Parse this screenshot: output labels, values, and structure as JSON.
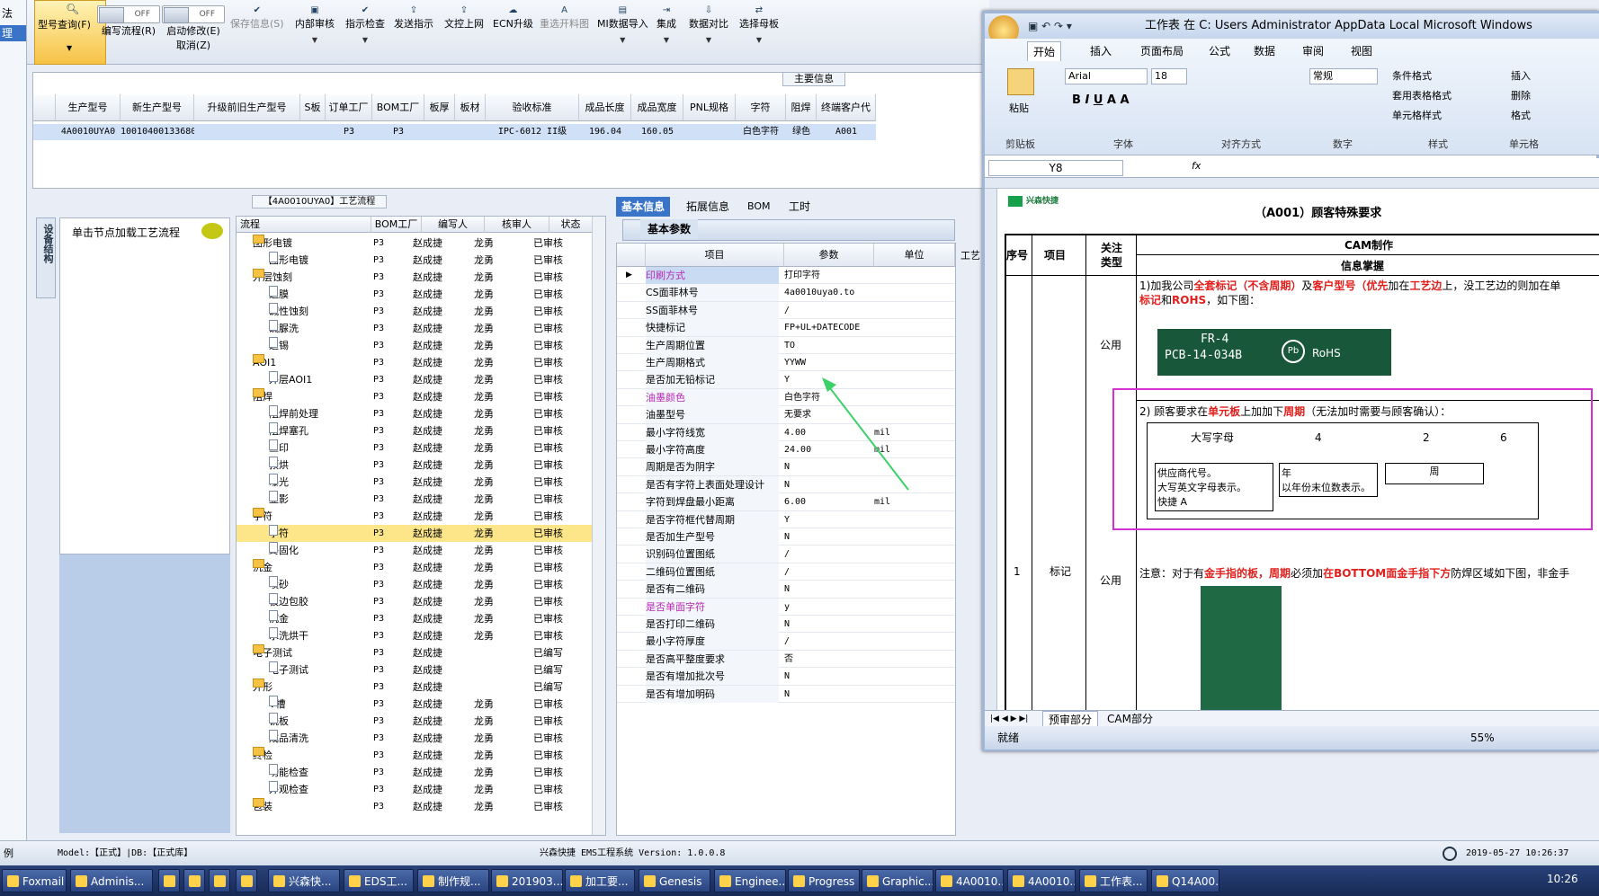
{
  "toolbar": {
    "buttons": [
      {
        "label": "型号查询(F)",
        "icon": "search-icon"
      },
      {
        "label": "编写流程(R)",
        "toggle": "OFF"
      },
      {
        "label": "启动修改(E)",
        "sub": "取消(Z)",
        "toggle": "OFF"
      },
      {
        "label": "保存信息(S)",
        "icon": "check-icon"
      },
      {
        "label": "内部审核",
        "icon": "print-icon"
      },
      {
        "label": "指示检查",
        "icon": "check-icon"
      },
      {
        "label": "发送指示",
        "icon": "upload-icon"
      },
      {
        "label": "文控上网",
        "icon": "upload-icon"
      },
      {
        "label": "ECN升级",
        "icon": "cloud-icon"
      },
      {
        "label": "重选开料图",
        "icon": "font-icon"
      },
      {
        "label": "MI数据导入",
        "icon": "image-icon"
      },
      {
        "label": "集成",
        "icon": "import-icon"
      },
      {
        "label": "数据对比",
        "icon": "download-icon"
      },
      {
        "label": "选择母板",
        "icon": "compare-icon"
      }
    ]
  },
  "left_strip": {
    "items": [
      "法",
      "理"
    ]
  },
  "main": {
    "caption": "主要信息",
    "columns": [
      "生产型号",
      "新生产型号",
      "升级前旧生产型号",
      "S板",
      "订单工厂",
      "BOM工厂",
      "板厚",
      "板材",
      "验收标准",
      "成品长度",
      "成品宽度",
      "PNL规格",
      "字符",
      "阻焊",
      "终端客户代码"
    ],
    "row": [
      "4A0010UYA0",
      "10010400133680",
      "",
      "",
      "P3",
      "P3",
      "",
      "",
      "IPC-6012 II级",
      "196.04",
      "160.05",
      "",
      "白色字符",
      "绿色",
      "A001"
    ]
  },
  "process": {
    "caption": "【4A0010UYA0】工艺流程",
    "vtab": "设备结构",
    "hint": "单击节点加载工艺流程",
    "columns": [
      "流程",
      "BOM工厂",
      "编写人",
      "核审人",
      "状态"
    ],
    "rows": [
      {
        "level": 1,
        "type": "folder",
        "name": "图形电镀",
        "bom": "P3",
        "author": "赵成捷",
        "reviewer": "龙勇",
        "status": "已审核"
      },
      {
        "level": 2,
        "type": "doc",
        "name": "图形电镀",
        "bom": "P3",
        "author": "赵成捷",
        "reviewer": "龙勇",
        "status": "已审核"
      },
      {
        "level": 1,
        "type": "folder",
        "name": "外层蚀刻",
        "bom": "P3",
        "author": "赵成捷",
        "reviewer": "龙勇",
        "status": "已审核"
      },
      {
        "level": 2,
        "type": "doc",
        "name": "退膜",
        "bom": "P3",
        "author": "赵成捷",
        "reviewer": "龙勇",
        "status": "已审核"
      },
      {
        "level": 2,
        "type": "doc",
        "name": "碱性蚀刻",
        "bom": "P3",
        "author": "赵成捷",
        "reviewer": "龙勇",
        "status": "已审核"
      },
      {
        "level": 2,
        "type": "doc",
        "name": "硫脲洗",
        "bom": "P3",
        "author": "赵成捷",
        "reviewer": "龙勇",
        "status": "已审核"
      },
      {
        "level": 2,
        "type": "doc",
        "name": "退锡",
        "bom": "P3",
        "author": "赵成捷",
        "reviewer": "龙勇",
        "status": "已审核"
      },
      {
        "level": 1,
        "type": "folder",
        "name": "AOI1",
        "bom": "P3",
        "author": "赵成捷",
        "reviewer": "龙勇",
        "status": "已审核"
      },
      {
        "level": 2,
        "type": "doc",
        "name": "外层AOI1",
        "bom": "P3",
        "author": "赵成捷",
        "reviewer": "龙勇",
        "status": "已审核"
      },
      {
        "level": 1,
        "type": "folder",
        "name": "阻焊",
        "bom": "P3",
        "author": "赵成捷",
        "reviewer": "龙勇",
        "status": "已审核"
      },
      {
        "level": 2,
        "type": "doc",
        "name": "阻焊前处理",
        "bom": "P3",
        "author": "赵成捷",
        "reviewer": "龙勇",
        "status": "已审核"
      },
      {
        "level": 2,
        "type": "doc",
        "name": "阻焊塞孔",
        "bom": "P3",
        "author": "赵成捷",
        "reviewer": "龙勇",
        "status": "已审核"
      },
      {
        "level": 2,
        "type": "doc",
        "name": "丝印",
        "bom": "P3",
        "author": "赵成捷",
        "reviewer": "龙勇",
        "status": "已审核"
      },
      {
        "level": 2,
        "type": "doc",
        "name": "预烘",
        "bom": "P3",
        "author": "赵成捷",
        "reviewer": "龙勇",
        "status": "已审核"
      },
      {
        "level": 2,
        "type": "doc",
        "name": "曝光",
        "bom": "P3",
        "author": "赵成捷",
        "reviewer": "龙勇",
        "status": "已审核"
      },
      {
        "level": 2,
        "type": "doc",
        "name": "显影",
        "bom": "P3",
        "author": "赵成捷",
        "reviewer": "龙勇",
        "status": "已审核"
      },
      {
        "level": 1,
        "type": "folder",
        "name": "字符",
        "bom": "P3",
        "author": "赵成捷",
        "reviewer": "龙勇",
        "status": "已审核"
      },
      {
        "level": 2,
        "type": "doc",
        "name": "字符",
        "bom": "P3",
        "author": "赵成捷",
        "reviewer": "龙勇",
        "status": "已审核",
        "selected": true
      },
      {
        "level": 2,
        "type": "doc",
        "name": "终固化",
        "bom": "P3",
        "author": "赵成捷",
        "reviewer": "龙勇",
        "status": "已审核"
      },
      {
        "level": 1,
        "type": "folder",
        "name": "沉金",
        "bom": "P3",
        "author": "赵成捷",
        "reviewer": "龙勇",
        "status": "已审核"
      },
      {
        "level": 2,
        "type": "doc",
        "name": "喷砂",
        "bom": "P3",
        "author": "赵成捷",
        "reviewer": "龙勇",
        "status": "已审核"
      },
      {
        "level": 2,
        "type": "doc",
        "name": "板边包胶",
        "bom": "P3",
        "author": "赵成捷",
        "reviewer": "龙勇",
        "status": "已审核"
      },
      {
        "level": 2,
        "type": "doc",
        "name": "沉金",
        "bom": "P3",
        "author": "赵成捷",
        "reviewer": "龙勇",
        "status": "已审核"
      },
      {
        "level": 2,
        "type": "doc",
        "name": "水洗烘干",
        "bom": "P3",
        "author": "赵成捷",
        "reviewer": "龙勇",
        "status": "已审核"
      },
      {
        "level": 1,
        "type": "folder",
        "name": "电子测试",
        "bom": "P3",
        "author": "赵成捷",
        "reviewer": "",
        "status": "已编写"
      },
      {
        "level": 2,
        "type": "doc",
        "name": "电子测试",
        "bom": "P3",
        "author": "赵成捷",
        "reviewer": "",
        "status": "已编写"
      },
      {
        "level": 1,
        "type": "folder",
        "name": "外形",
        "bom": "P3",
        "author": "赵成捷",
        "reviewer": "",
        "status": "已编写"
      },
      {
        "level": 2,
        "type": "doc",
        "name": "V槽",
        "bom": "P3",
        "author": "赵成捷",
        "reviewer": "龙勇",
        "status": "已审核"
      },
      {
        "level": 2,
        "type": "doc",
        "name": "铣板",
        "bom": "P3",
        "author": "赵成捷",
        "reviewer": "龙勇",
        "status": "已审核"
      },
      {
        "level": 2,
        "type": "doc",
        "name": "成品清洗",
        "bom": "P3",
        "author": "赵成捷",
        "reviewer": "龙勇",
        "status": "已审核"
      },
      {
        "level": 1,
        "type": "folder",
        "name": "终检",
        "bom": "P3",
        "author": "赵成捷",
        "reviewer": "龙勇",
        "status": "已审核"
      },
      {
        "level": 2,
        "type": "doc",
        "name": "功能检查",
        "bom": "P3",
        "author": "赵成捷",
        "reviewer": "龙勇",
        "status": "已审核"
      },
      {
        "level": 2,
        "type": "doc",
        "name": "外观检查",
        "bom": "P3",
        "author": "赵成捷",
        "reviewer": "龙勇",
        "status": "已审核"
      },
      {
        "level": 1,
        "type": "folder",
        "name": "包装",
        "bom": "P3",
        "author": "赵成捷",
        "reviewer": "龙勇",
        "status": "已审核"
      }
    ]
  },
  "params": {
    "tabs": [
      "基本信息",
      "拓展信息",
      "BOM",
      "工时"
    ],
    "sub": "基本参数",
    "side_label": "工艺",
    "columns": [
      "项目",
      "参数",
      "单位"
    ],
    "rows": [
      {
        "k": "印刷方式",
        "v": "打印字符",
        "u": "",
        "hl": true,
        "sel": true
      },
      {
        "k": "CS面菲林号",
        "v": "4a0010uya0.to",
        "u": ""
      },
      {
        "k": "SS面菲林号",
        "v": "/",
        "u": ""
      },
      {
        "k": "快捷标记",
        "v": "FP+UL+DATECODE",
        "u": ""
      },
      {
        "k": "生产周期位置",
        "v": "TO",
        "u": ""
      },
      {
        "k": "生产周期格式",
        "v": "YYWW",
        "u": ""
      },
      {
        "k": "是否加无铅标记",
        "v": "Y",
        "u": ""
      },
      {
        "k": "油墨颜色",
        "v": "白色字符",
        "u": "",
        "hl": true
      },
      {
        "k": "油墨型号",
        "v": "无要求",
        "u": ""
      },
      {
        "k": "最小字符线宽",
        "v": "4.00",
        "u": "mil"
      },
      {
        "k": "最小字符高度",
        "v": "24.00",
        "u": "mil"
      },
      {
        "k": "周期是否为阴字",
        "v": "N",
        "u": ""
      },
      {
        "k": "是否有字符上表面处理设计",
        "v": "N",
        "u": ""
      },
      {
        "k": "字符到焊盘最小距离",
        "v": "6.00",
        "u": "mil"
      },
      {
        "k": "是否字符框代替周期",
        "v": "Y",
        "u": ""
      },
      {
        "k": "是否加生产型号",
        "v": "N",
        "u": ""
      },
      {
        "k": "识别码位置图纸",
        "v": "/",
        "u": ""
      },
      {
        "k": "二维码位置图纸",
        "v": "/",
        "u": ""
      },
      {
        "k": "是否有二维码",
        "v": "N",
        "u": ""
      },
      {
        "k": "是否单面字符",
        "v": "y",
        "u": "",
        "hl": true
      },
      {
        "k": "是否打印二维码",
        "v": "N",
        "u": ""
      },
      {
        "k": "最小字符厚度",
        "v": "/",
        "u": ""
      },
      {
        "k": "是否高平整度要求",
        "v": "否",
        "u": ""
      },
      {
        "k": "是否有增加批次号",
        "v": "N",
        "u": ""
      },
      {
        "k": "是否有增加明码",
        "v": "N",
        "u": ""
      }
    ]
  },
  "excel": {
    "title": "工作表 在 C: Users Administrator AppData Local Microsoft Windows Temporary...",
    "ribbon_tabs": [
      "开始",
      "插入",
      "页面布局",
      "公式",
      "数据",
      "审阅",
      "视图"
    ],
    "font": "Arial",
    "font_size": "18",
    "number_format": "常规",
    "groups": [
      "剪贴板",
      "字体",
      "对齐方式",
      "数字",
      "样式",
      "单元格"
    ],
    "styles": [
      "条件格式",
      "套用表格格式",
      "单元格样式"
    ],
    "cells_actions": [
      "插入",
      "删除",
      "格式"
    ],
    "paste": "粘贴",
    "name_box": "Y8",
    "logo": "兴森快捷",
    "doc_title": "（A001）顾客特殊要求",
    "headers": {
      "seq": "序号",
      "item": "项目",
      "type": "关注类型",
      "cam": "CAM制作",
      "info": "信息掌握"
    },
    "row1_seq": "1",
    "row1_item": "标记",
    "row_type": "公用",
    "note1_a": "1)加我公司",
    "note1_b": "全套标记（不含周期）",
    "note1_c": "及",
    "note1_d": "客户型号（优先",
    "note1_e": "加在",
    "note1_f": "工艺边",
    "note1_g": "上，没工艺边的则加在单",
    "note1_h": "标记",
    "note1_i": "和",
    "note1_j": "ROHS",
    "note1_k": "，如下图：",
    "pcb_text1": "FR-4",
    "pcb_text2": "PCB-14-034B",
    "pcb_rohs": "RoHS",
    "pcb_pb": "Pb",
    "note2_a": "2) 顾客要求在",
    "note2_b": "单元板",
    "note2_c": "上加加下",
    "note2_d": "周期",
    "note2_e": "（无法加时需要与顾客确认）：",
    "diag": {
      "caps": "大写字母",
      "n4": "4",
      "n2": "2",
      "n6": "6",
      "box1_l1": "供应商代号。",
      "box1_l2": "大写英文字母表示。",
      "box1_l3": "快捷 A",
      "box2_l1": "年",
      "box2_l2": "以年份末位数表示。",
      "box3": "周"
    },
    "note3_a": "注意：对于有",
    "note3_b": "金手指",
    "note3_c": "的板，",
    "note3_d": "周期",
    "note3_e": "必须加",
    "note3_f": "在BOTTOM面金手指下方",
    "note3_g": "防焊区域如下图，非金手",
    "sheet_tabs": [
      "预审部分",
      "CAM部分"
    ],
    "status": "就绪",
    "zoom": "55%"
  },
  "statusbar": {
    "left": "例",
    "model": "Model:【正式】|DB:【正式库】",
    "center": "兴森快捷 EMS工程系统 Version: 1.0.0.8",
    "datetime": "2019-05-27 10:26:37"
  },
  "taskbar": {
    "items": [
      "Foxmail",
      "Adminis...",
      "",
      "",
      "",
      "",
      "兴森快...",
      "EDS工...",
      "制作规...",
      "201903...",
      "加工要...",
      "Genesis",
      "Enginee...",
      "Progress",
      "Graphic...",
      "4A0010...",
      "4A0010...",
      "工作表...",
      "Q14A00..."
    ],
    "clock": "10:26"
  }
}
